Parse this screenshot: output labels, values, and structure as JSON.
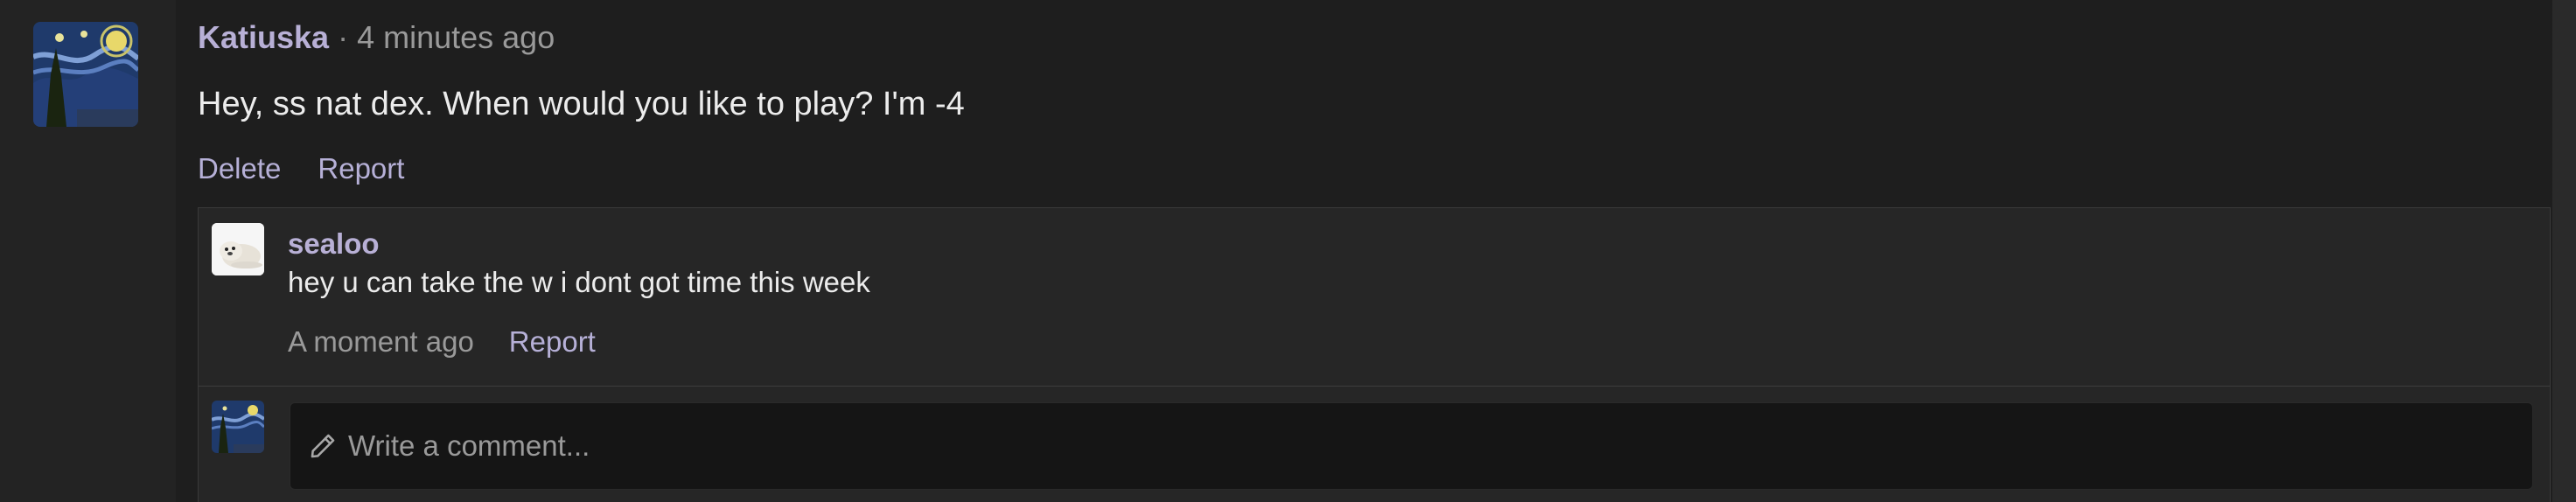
{
  "post": {
    "author": "Katiuska",
    "separator": "·",
    "timestamp": "4 minutes ago",
    "text": "Hey, ss nat dex. When would you like to play? I'm -4",
    "actions": {
      "delete": "Delete",
      "report": "Report"
    },
    "avatar_icon": "starry-night-avatar-icon"
  },
  "reply": {
    "author": "sealoo",
    "text": "hey u can take the w i dont got time this week",
    "timestamp": "A moment ago",
    "report": "Report",
    "avatar_icon": "seal-avatar-icon"
  },
  "comment_box": {
    "placeholder": "Write a comment...",
    "icon": "pencil-icon",
    "avatar_icon": "starry-night-avatar-icon"
  },
  "colors": {
    "background": "#1e1e1e",
    "username": "#b8b0d6",
    "link": "#b6b0d7",
    "text": "#ececec",
    "muted": "#9a9a9a"
  }
}
